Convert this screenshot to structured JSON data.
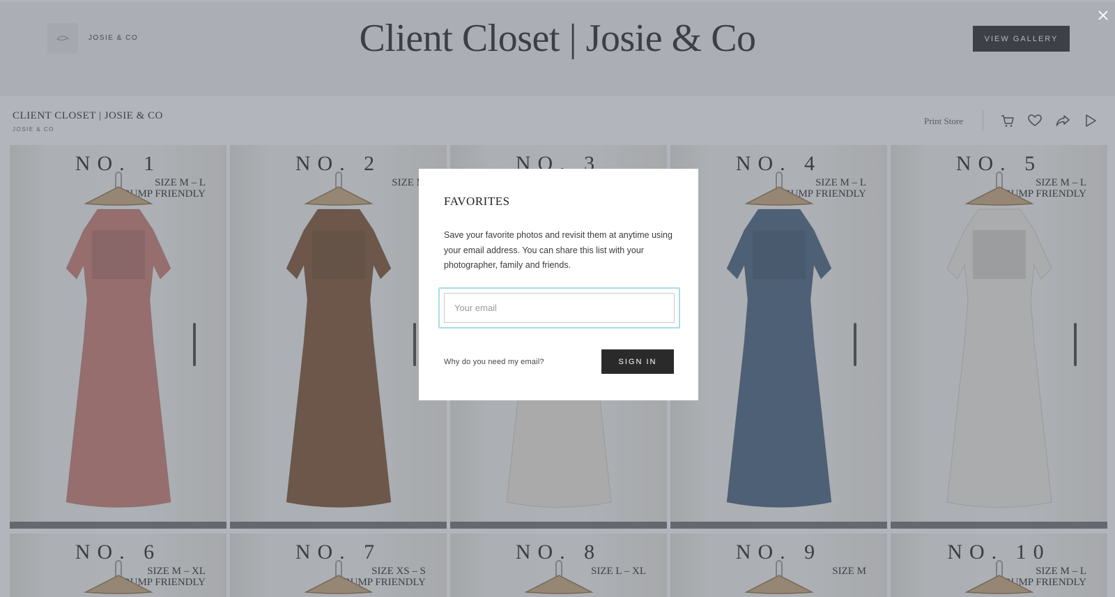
{
  "header": {
    "brand_name": "JOSIE & CO",
    "hero_title": "Client Closet | Josie & Co",
    "view_gallery_label": "VIEW GALLERY"
  },
  "subheader": {
    "title": "CLIENT CLOSET | JOSIE & CO",
    "subtitle": "JOSIE & CO",
    "print_store_label": "Print Store",
    "tool_icons": [
      "cart-icon",
      "heart-icon",
      "share-icon",
      "play-icon"
    ]
  },
  "tiles": [
    {
      "number": "NO. 1",
      "size": "SIZE M – L\nBUMP FRIENDLY",
      "dress_color": "#c9756a"
    },
    {
      "number": "NO. 2",
      "size": "SIZE M",
      "dress_color": "#7a4a26"
    },
    {
      "number": "NO. 3",
      "size": "",
      "dress_color": "#efe9dc"
    },
    {
      "number": "NO. 4",
      "size": "SIZE M – L\nBUMP FRIENDLY",
      "dress_color": "#3f5a7a"
    },
    {
      "number": "NO. 5",
      "size": "SIZE M – L\nBUMP FRIENDLY",
      "dress_color": "#f1ece2"
    },
    {
      "number": "NO. 6",
      "size": "SIZE M – XL\nBUMP FRIENDLY",
      "dress_color": "#d8cfc2"
    },
    {
      "number": "NO. 7",
      "size": "SIZE XS – S\nBUMP FRIENDLY",
      "dress_color": "#d8cfc2"
    },
    {
      "number": "NO. 8",
      "size": "SIZE L – XL",
      "dress_color": "#d8cfc2"
    },
    {
      "number": "NO. 9",
      "size": "SIZE M",
      "dress_color": "#d8cfc2"
    },
    {
      "number": "NO. 10",
      "size": "SIZE M – L\nBUMP FRIENDLY",
      "dress_color": "#d8cfc2"
    }
  ],
  "modal": {
    "title": "FAVORITES",
    "description": "Save your favorite photos and revisit them at anytime using your email address. You can share this list with your photographer, family and friends.",
    "email_placeholder": "Your email",
    "email_value": "",
    "why_link": "Why do you need my email?",
    "sign_in_label": "SIGN IN"
  },
  "colors": {
    "overlay": "#5f6673",
    "button_dark": "#1f1f1f",
    "input_focus": "#a9dde8"
  }
}
